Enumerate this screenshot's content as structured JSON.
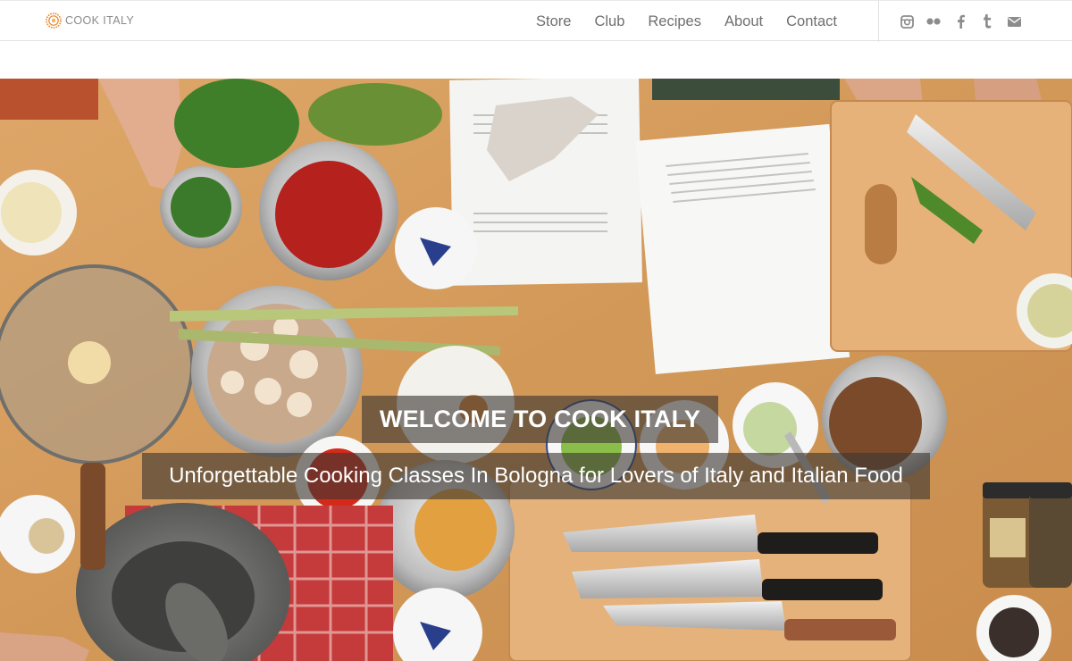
{
  "brand": {
    "name": "COOK ITALY",
    "accent": "#e8872a"
  },
  "nav": {
    "items": [
      {
        "label": "Store"
      },
      {
        "label": "Club"
      },
      {
        "label": "Recipes"
      },
      {
        "label": "About"
      },
      {
        "label": "Contact"
      }
    ]
  },
  "social": [
    {
      "icon": "instagram-icon"
    },
    {
      "icon": "flickr-icon"
    },
    {
      "icon": "facebook-icon"
    },
    {
      "icon": "tumblr-icon"
    },
    {
      "icon": "mail-icon"
    }
  ],
  "hero": {
    "title": "WELCOME TO COOK ITALY",
    "subtitle": "Unforgettable Cooking Classes In Bologna for Lovers of Italy and Italian Food"
  },
  "colors": {
    "nav_text": "#6f6f6f",
    "icon": "#8c8c8c",
    "overlay": "#3c3732"
  }
}
